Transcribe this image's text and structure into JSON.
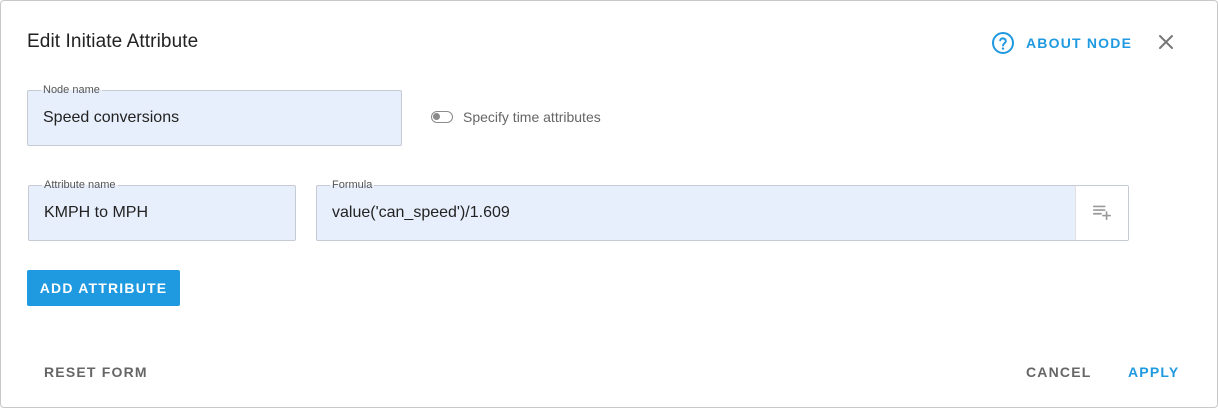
{
  "dialog": {
    "title": "Edit Initiate Attribute",
    "about_label": "ABOUT NODE"
  },
  "node_name": {
    "label": "Node name",
    "value": "Speed conversions"
  },
  "time_toggle": {
    "label": "Specify time attributes",
    "checked": false
  },
  "attribute": {
    "name_label": "Attribute name",
    "name_value": "KMPH to MPH",
    "formula_label": "Formula",
    "formula_value": "value('can_speed')/1.609"
  },
  "buttons": {
    "add_attribute": "ADD ATTRIBUTE",
    "reset_form": "RESET FORM",
    "cancel": "CANCEL",
    "apply": "APPLY"
  },
  "colors": {
    "accent": "#1f9ae0",
    "field_bg": "#e8effc",
    "muted_text": "#666666"
  },
  "icons": {
    "help": "help-circle-icon",
    "close": "close-icon",
    "formula": "playlist-add-icon"
  }
}
